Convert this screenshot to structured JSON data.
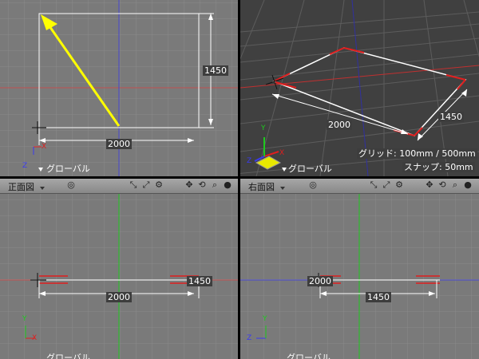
{
  "colors": {
    "grid_bg": "#7a7a7a",
    "grid_line": "#8a8a8a",
    "persp_bg": "#404040",
    "axis_red": "#e01e1e",
    "axis_green": "#1ec81e",
    "axis_blue": "#3a3af0",
    "arrow_yellow": "#ffff00",
    "toolbar": "#999999"
  },
  "views": {
    "top": {
      "width_label": "2000",
      "depth_label": "1450",
      "axis_label": "グローバル",
      "axis_x": "X",
      "axis_z": "Z"
    },
    "perspective": {
      "width_label": "2000",
      "depth_label": "1450",
      "axis_label": "グローバル",
      "grid_info": "グリッド: 100mm / 500mm",
      "snap_info": "スナップ: 50mm",
      "axis_x": "X",
      "axis_y": "Y",
      "axis_z": "Z"
    },
    "front": {
      "title": "正面図",
      "width_label": "2000",
      "depth_label": "1450",
      "axis_label": "グローバル",
      "axis_x": "X",
      "axis_y": "Y"
    },
    "right": {
      "title": "右面図",
      "width_label": "1450",
      "depth_label": "2000",
      "axis_label": "グローバル",
      "axis_y": "Y",
      "axis_z": "Z"
    }
  },
  "toolbar_icons": [
    "target-icon",
    "view-fit-icon",
    "view-fit-all-icon",
    "settings-icon",
    "pan-icon",
    "rotate-icon",
    "zoom-icon",
    "sphere-icon"
  ]
}
